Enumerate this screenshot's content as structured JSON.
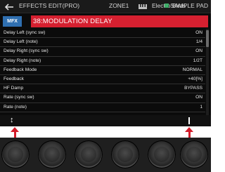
{
  "topbar": {
    "breadcrumb": "EFFECTS EDIT(PRO)",
    "zone": "ZONE1",
    "instrument": "Electro Birds",
    "mode": "SAMPLE PAD",
    "mode_color": "#3fae6a"
  },
  "header": {
    "badge": "MFX",
    "badge_color": "#2f6fb0",
    "title": "38:MODULATION DELAY",
    "title_color": "#d62030"
  },
  "params": [
    {
      "name": "Delay Left (sync sw)",
      "value": "ON"
    },
    {
      "name": "Delay Left (note)",
      "value": "1/4"
    },
    {
      "name": "Delay Right (sync sw)",
      "value": "ON"
    },
    {
      "name": "Delay Right (note)",
      "value": "1/2T"
    },
    {
      "name": "Feedback Mode",
      "value": "NORMAL"
    },
    {
      "name": "Feedback",
      "value": "+40[%]"
    },
    {
      "name": "HF Damp",
      "value": "BYPASS"
    },
    {
      "name": "Rate (sync sw)",
      "value": "ON"
    },
    {
      "name": "Rate (note)",
      "value": "1"
    }
  ],
  "bottom": {
    "left_icon": "up-down-arrow-icon",
    "left_glyph": "↕",
    "right_icon": "vertical-bar-icon"
  },
  "annotation_color": "#d31c2a",
  "knob_count": 6
}
